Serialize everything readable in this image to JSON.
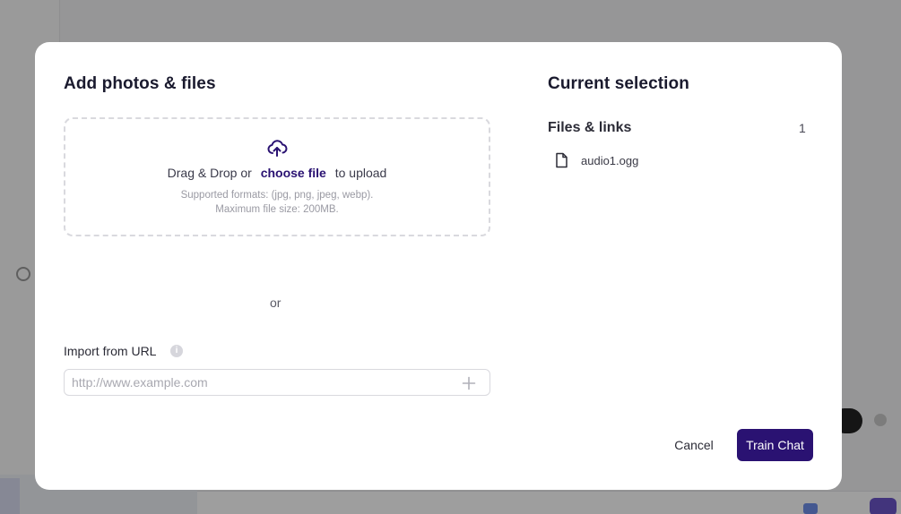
{
  "modal": {
    "title": "Add photos & files",
    "dropzone": {
      "prefix": "Drag & Drop or",
      "link": "choose file",
      "suffix": "to upload",
      "formats": "Supported formats: (jpg, png, jpeg, webp).",
      "max_size": "Maximum file size: 200MB."
    },
    "or_label": "or",
    "import_url": {
      "label": "Import from URL",
      "placeholder": "http://www.example.com",
      "value": ""
    },
    "selection": {
      "title": "Current selection",
      "section_title": "Files & links",
      "count": "1",
      "files": [
        {
          "name": "audio1.ogg",
          "icon": "file-icon"
        }
      ]
    },
    "actions": {
      "cancel": "Cancel",
      "train": "Train Chat"
    }
  },
  "colors": {
    "accent": "#2a1272",
    "overlay": "rgba(0,0,0,0.38)"
  }
}
